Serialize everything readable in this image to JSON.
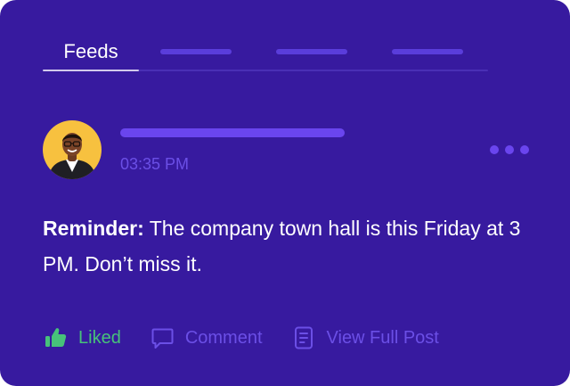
{
  "tabs": {
    "active_label": "Feeds",
    "placeholder_count": 3
  },
  "post": {
    "time": "03:35 PM",
    "body_bold": "Reminder:",
    "body_text": " The company town hall is this Friday at 3 PM. Don’t miss it."
  },
  "actions": {
    "liked_label": "Liked",
    "comment_label": "Comment",
    "view_label": "View Full Post"
  },
  "colors": {
    "background": "#371a9f",
    "accent": "#6a45ee",
    "liked": "#47c27a",
    "avatar_bg": "#f7c13f"
  },
  "icons": {
    "like": "thumbs-up-icon",
    "comment": "comment-bubble-icon",
    "view": "document-icon",
    "more": "more-dots-icon"
  }
}
